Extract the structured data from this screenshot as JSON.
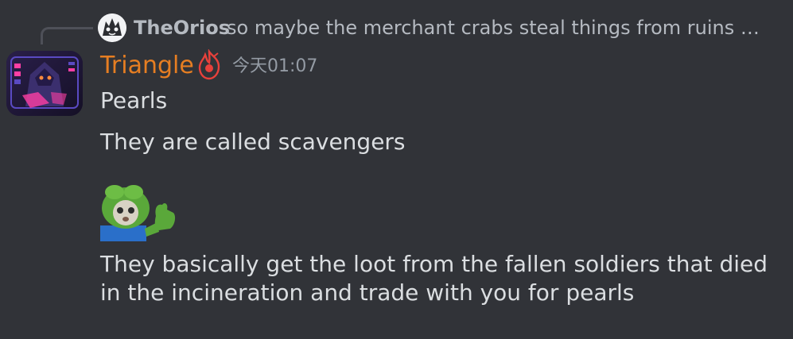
{
  "reply": {
    "username": "TheOrios",
    "text": "so maybe the merchant crabs steal things from ruins or something"
  },
  "message": {
    "author": "Triangle",
    "author_color": "#e67e22",
    "timestamp": "今天01:07",
    "lines": [
      "Pearls",
      "They are called scavengers",
      "They basically get the loot from the fallen soldiers that died in the incineration and trade with you for pearls"
    ],
    "emoji": "frog-thumbs-up-emoji"
  },
  "colors": {
    "background": "#313338",
    "text": "#dbdee1",
    "muted": "#b5bac1",
    "timestamp": "#949ba4"
  }
}
